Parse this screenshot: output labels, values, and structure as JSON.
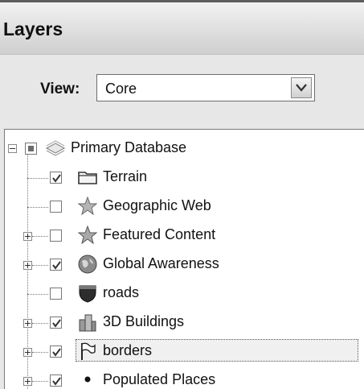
{
  "header": {
    "title": "Layers"
  },
  "view": {
    "label": "View:",
    "selected": "Core"
  },
  "layers": [
    {
      "name": "Primary Database",
      "icon": "database-icon",
      "checked": "partial"
    },
    {
      "name": "Terrain",
      "icon": "folder-icon",
      "checked": true
    },
    {
      "name": "Geographic Web",
      "icon": "star-icon",
      "checked": false
    },
    {
      "name": "Featured Content",
      "icon": "star-icon",
      "checked": false
    },
    {
      "name": "Global Awareness",
      "icon": "globe-icon",
      "checked": true
    },
    {
      "name": "roads",
      "icon": "road-shield-icon",
      "checked": false
    },
    {
      "name": "3D Buildings",
      "icon": "buildings-icon",
      "checked": true
    },
    {
      "name": "borders",
      "icon": "border-flag-icon",
      "checked": true
    },
    {
      "name": "Populated Places",
      "icon": "dot-icon",
      "checked": true
    }
  ]
}
